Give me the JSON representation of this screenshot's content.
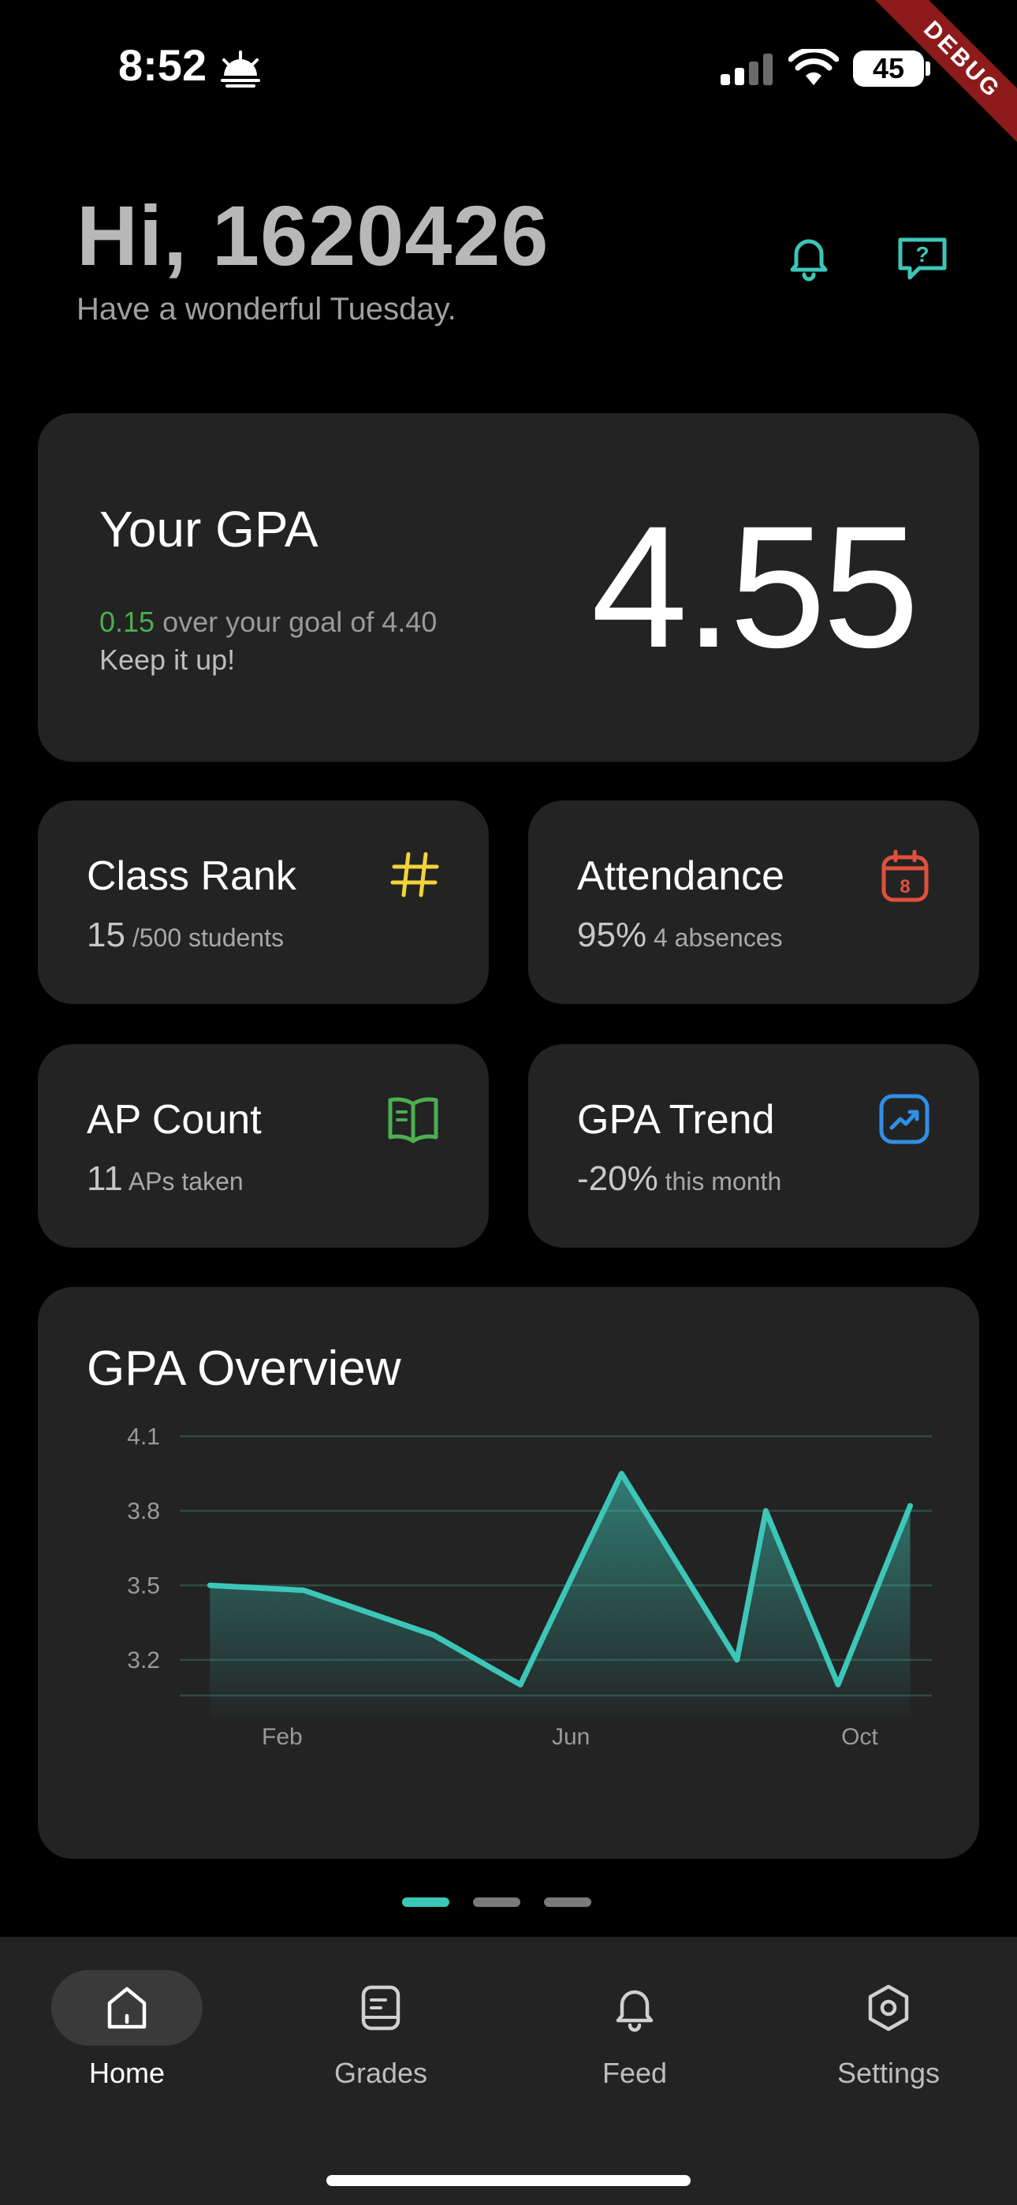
{
  "status_bar": {
    "time": "8:52",
    "battery": "45"
  },
  "debug_label": "DEBUG",
  "header": {
    "greeting": "Hi, 1620426",
    "subtitle": "Have a wonderful Tuesday."
  },
  "gpa_card": {
    "title": "Your GPA",
    "value": "4.55",
    "goal_delta": "0.15",
    "goal_text": " over your goal of 4.40",
    "encouragement": "Keep it up!"
  },
  "stats": {
    "class_rank": {
      "title": "Class Rank",
      "value": "15",
      "detail": " /500 students"
    },
    "attendance": {
      "title": "Attendance",
      "value": "95%",
      "detail": " 4 absences",
      "calendar_day": "8"
    },
    "ap_count": {
      "title": "AP Count",
      "value": "11",
      "detail": " APs taken"
    },
    "gpa_trend": {
      "title": "GPA Trend",
      "value": "-20%",
      "detail": " this month"
    }
  },
  "colors": {
    "accent": "#3cc6b8",
    "green": "#4caf50",
    "yellow": "#f2d33b",
    "red": "#e0503c",
    "blue": "#2f8fe6"
  },
  "chart_data": {
    "type": "area",
    "title": "GPA Overview",
    "x": [
      1,
      2,
      3,
      4,
      5,
      6,
      7,
      8,
      9,
      10,
      11
    ],
    "y_ticks": [
      4.1,
      3.8,
      3.5,
      3.2
    ],
    "x_ticks": [
      {
        "value": 2,
        "label": "Feb"
      },
      {
        "value": 6,
        "label": "Jun"
      },
      {
        "value": 10,
        "label": "Oct"
      }
    ],
    "series": [
      {
        "values": [
          3.5,
          3.48,
          3.3,
          3.1,
          3.95,
          3.2,
          3.8,
          3.1,
          3.82
        ]
      }
    ],
    "series_x": [
      1,
      2.3,
      4.1,
      5.3,
      6.7,
      8.3,
      8.7,
      9.7,
      10.7
    ],
    "ylim": [
      3.05,
      4.05
    ],
    "xlim": [
      0.8,
      11.0
    ],
    "grid": true
  },
  "pager": {
    "count": 3,
    "active": 0
  },
  "nav": [
    {
      "label": "Home",
      "icon": "home-icon"
    },
    {
      "label": "Grades",
      "icon": "document-icon"
    },
    {
      "label": "Feed",
      "icon": "bell-icon"
    },
    {
      "label": "Settings",
      "icon": "settings-icon"
    }
  ]
}
